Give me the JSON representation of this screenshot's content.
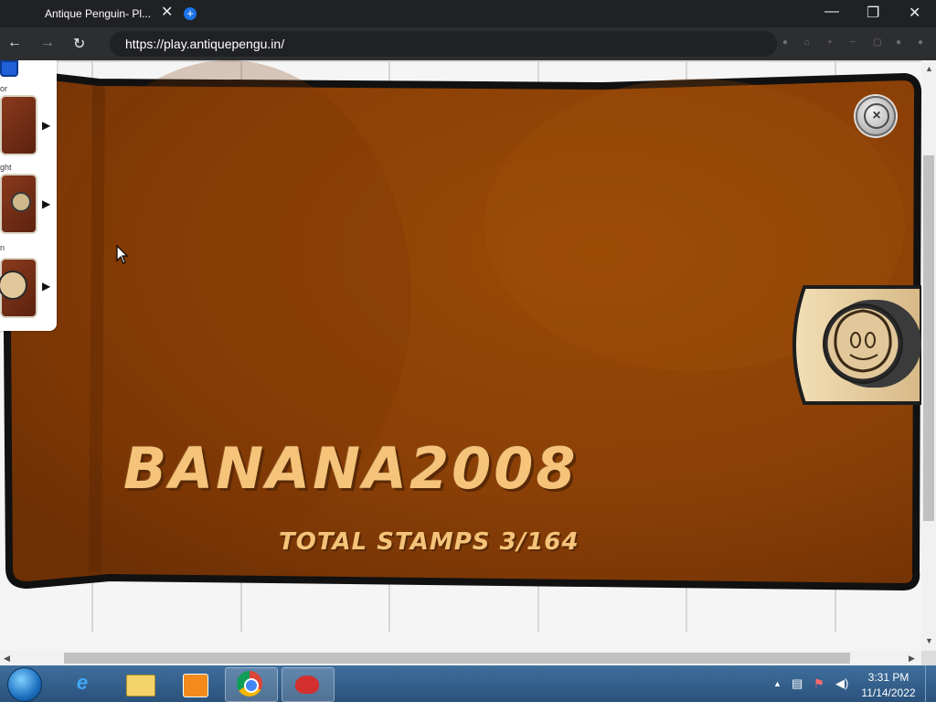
{
  "browser": {
    "tab_title": "Antique Penguin- Pl...",
    "close_tab": "✕",
    "new_tab": "+",
    "url": "https://play.antiquepengu.in/",
    "minimize": "—",
    "restore": "❐",
    "close_window": "✕",
    "back": "←",
    "forward": "→",
    "reload": "↻"
  },
  "side_panel": {
    "labels": [
      "or",
      "ght",
      "n"
    ],
    "arrow": "▶"
  },
  "stamp_book": {
    "player_name": "BANANA2008",
    "total_stamps": "TOTAL STAMPS 3/164",
    "close_glyph": "×"
  },
  "colors": {
    "book_brown": "#8a3f06",
    "book_border": "#111111",
    "title_text": "#f5c47a"
  },
  "taskbar": {
    "time": "3:31 PM",
    "date": "11/14/2022",
    "tray_arrow": "▲"
  }
}
